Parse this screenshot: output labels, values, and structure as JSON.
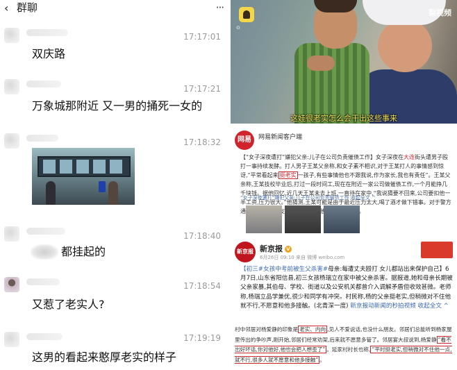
{
  "header": {
    "back_icon": "‹",
    "title": "群聊",
    "more_icon": "···"
  },
  "messages": [
    {
      "time": "17:17:01",
      "text": "双庆路"
    },
    {
      "time": "17:17:21",
      "text": "万象城那附近 又一男的捅死一女的"
    },
    {
      "time": "17:18:32",
      "text": ""
    },
    {
      "time": "17:18:40",
      "text": "都挂起的"
    },
    {
      "time": "17:18:54",
      "text": "又惹了老实人?"
    },
    {
      "time": "17:19:19",
      "text": "这男的看起来憨厚老实的样子"
    }
  ],
  "video": {
    "app_caption": "⊙",
    "watermark": "梨视频",
    "subtitle": "这娃很老实怎么会干出这些事来"
  },
  "netease_post": {
    "logo": "网易",
    "source": "网易新闻客户端",
    "sub": "",
    "text_a": "【“女子深夜遭打”嫌犯父亲:儿子在公司负责催债工作】女子深夜在",
    "text_red": "大连",
    "text_b": "街头遭男子殴打一事持续发酵。打人男子王某父亲称,和女子素不相识,对于王某打人的事情感到惊讶,“平常看起来",
    "text_box": "挺老实",
    "text_c": "一孩子,有些事情他也不跟我说,作为家长,我也有责任”。王某父亲称,王某技校毕业后,打过一段时间工,现在在附近一家公司做催债工作,一个月能挣几千块钱。据他回忆,近几天王某未去上班,一直待在家中,“我说猜要不回来,公司要扣他一半工资,压力很大。”他猜测,王某可能是由于最近压力太大,喝了酒才做下错事。对于警方通报中王某与女友感情纠纷一事,他表示并不知情。",
    "link": "“女子深夜遭打”嫌犯父亲:儿子在公司负责催债工作 收起全文 ^"
  },
  "xinjingbao_post": {
    "logo": "新京报",
    "name": "新京报",
    "verified": "V",
    "meta": "6月26日 09:10 来自 微博 weibo.com",
    "tag": "【初三#女孩中考前被生父杀害#",
    "text": "母亲:每遭丈夫殴打 女儿都站出来保护自己】6月7日,山东省阳信县,初三女孩杨瑞立在家中被父亲杀害。据报道,她和母亲长期被父亲家暴,其伯母、学校、街道以及公安机关都曾介入调解矛盾但收效甚微。老师称,杨瑞立品学兼优,很少和同学有冲突。村民称,杨的父亲挺老实,但稍微对不住他就不行,不愿意和他多接触。(北青深一度)",
    "link": "新京报动新闻的秒拍视频 收起全文 ^"
  },
  "bottom_text": {
    "a": "村中邻居对杨爱静的印象是",
    "box1": "老实、内向",
    "b": ",见人不爱说话,也没什么朋友。邻居们总能听到杨家屋里传出的争吵声,刚开始,邻居们经常劝架,后来就不愿意多管了。邻居宴大叔说到,杨爱静",
    "box2": "“看不出好坏话,你对他好,他也会把人想歪了”",
    "c": "。",
    "d": "延家村村长也称,",
    "box3": "“平时挺老实,但稍微对不住他一点,就不行,很多人就不愿意和他多接触”",
    "e": "。"
  },
  "colors": {
    "accent_red": "#d0242c",
    "link_blue": "#4b6ea8",
    "timestamp_gray": "#9a9a9a"
  }
}
